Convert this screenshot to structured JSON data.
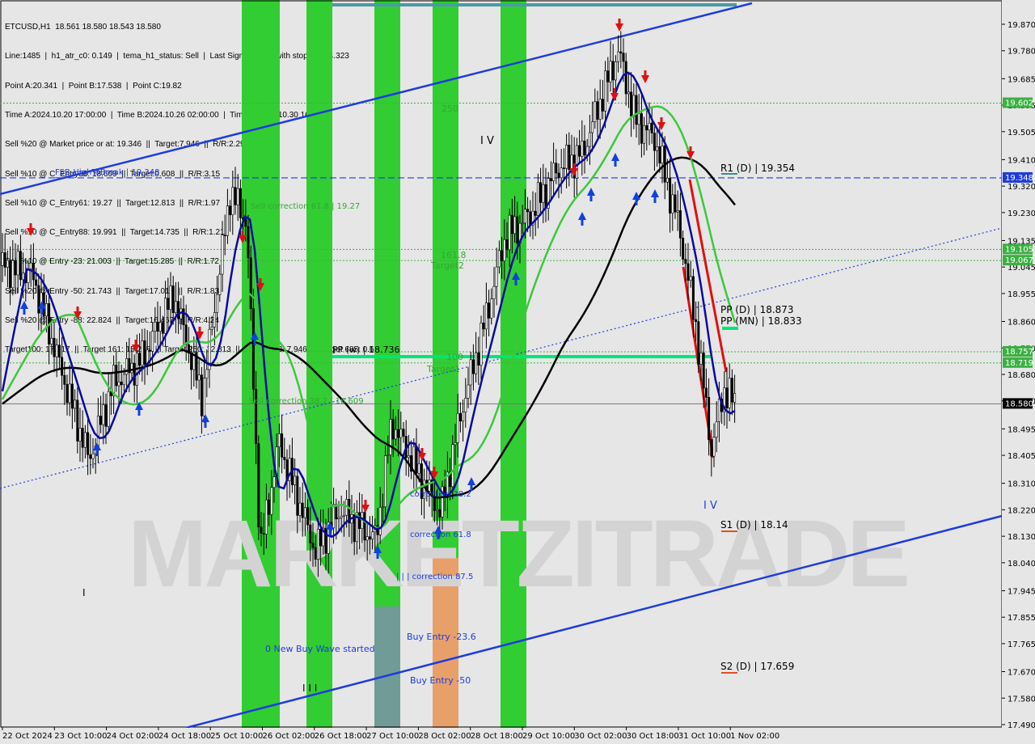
{
  "header": {
    "title": "ETCUSD,H1  18.561 18.580 18.543 18.580",
    "lines": [
      "Line:1485  |  h1_atr_c0: 0.149  |  tema_h1_status: Sell  |  Last Signal is:Sell with stoploss:24.323",
      "Point A:20.341  |  Point B:17.538  |  Point C:19.82",
      "Time A:2024.10.20 17:00:00  |  Time B:2024.10.26 02:00:00  |  Time C:2024.10.30 16:00:00",
      "Sell %20 @ Market price or at: 19.346  ||  Target:7.946  ||  R/R:2.29",
      "Sell %10 @ C_Entry38: 18.609  ||  Target:0.608  ||  R/R:3.15",
      "Sell %10 @ C_Entry61: 19.27  ||  Target:12.813  ||  R/R:1.97",
      "Sell %10 @ C_Entry88: 19.991  ||  Target:14.735  ||  R/R:1.21",
      "Sell %10 @ Entry -23: 21.003  ||  Target:15.285  ||  R/R:1.72",
      "Sell %20 @ Entry -50: 21.743  ||  Target:17.017  ||  R/R:1.83",
      "Sell %20 @ Entry -88: 22.824  ||  Target:16.467  ||  R/R:4.24",
      "Target100: 17.017  ||  Target 161: 15.285  ||  Target 250: 12.813  ||  Target 423: 7.946  ||  Target 685: 0.608"
    ]
  },
  "watermark": "MARKETZITRADE",
  "price_axis": {
    "ticks": [
      "19.870",
      "19.780",
      "19.685",
      "19.595",
      "19.505",
      "19.410",
      "19.320",
      "19.230",
      "19.135",
      "19.045",
      "18.955",
      "18.860",
      "18.770",
      "18.680",
      "18.590",
      "18.495",
      "18.405",
      "18.310",
      "18.220",
      "18.130",
      "18.040",
      "17.945",
      "17.855",
      "17.765",
      "17.670",
      "17.580",
      "17.490"
    ],
    "highlights": [
      {
        "label": "19.602",
        "price": 19.602,
        "color": "#3cb043"
      },
      {
        "label": "19.348",
        "price": 19.348,
        "color": "#1e3cdc"
      },
      {
        "label": "19.105",
        "price": 19.105,
        "color": "#3cb043"
      },
      {
        "label": "19.067",
        "price": 19.067,
        "color": "#3cb043"
      },
      {
        "label": "18.757",
        "price": 18.757,
        "color": "#3cb043"
      },
      {
        "label": "18.719",
        "price": 18.719,
        "color": "#3cb043"
      },
      {
        "label": "18.580",
        "price": 18.58,
        "color": "#000000"
      }
    ]
  },
  "time_axis": {
    "labels": [
      "22 Oct 2024",
      "23 Oct 10:00",
      "24 Oct 02:00",
      "24 Oct 18:00",
      "25 Oct 10:00",
      "26 Oct 02:00",
      "26 Oct 18:00",
      "27 Oct 10:00",
      "28 Oct 02:00",
      "28 Oct 18:00",
      "29 Oct 10:00",
      "30 Oct 02:00",
      "30 Oct 18:00",
      "31 Oct 10:00",
      "1 Nov 02:00"
    ]
  },
  "annotations": {
    "fsb": "FSB-HighToBreak  |  19.348",
    "r1": "R1 (D)  |  19.354",
    "pp_d": "PP (D)  |  18.873",
    "pp_mn": "PP (MN)  |  18.833",
    "pp_w": "PP (w)  |  18.736",
    "s1": "S1 (D)  |  18.14",
    "s2": "S2 (D)  |  17.659",
    "sell_corr_61": "Sell correction 61.8  |  19.27",
    "sell_corr_38": "Sell correction 38.2  |  18.609",
    "label_250": "250",
    "label_1618": "161.8",
    "target2": "Target2",
    "label_100": "100",
    "target1": "Target1",
    "corr_382": "correction 38.2",
    "corr_618": "correction 61.8",
    "corr_875": "| | | correction 87.5",
    "buy_236": "Buy Entry -23.6",
    "buy_50": "Buy Entry -50",
    "new_wave": "0 New Buy Wave started",
    "wave_iv_top": "I V",
    "wave_iv_bottom": "I V",
    "wave_iii": "I I I",
    "wave_i": "I"
  },
  "colors": {
    "background": "#e6e6e6",
    "candle": "#000000",
    "green_zone": "#32cd32",
    "orange_zone": "#e8a06a",
    "teal_zone": "#4a9aa6",
    "ema_blue": "#0a0aa0",
    "ema_green": "#3cc83c",
    "ema_black": "#000000",
    "channel_blue": "#1e3cdc",
    "arrow_red": "#e01010",
    "arrow_blue": "#1040e0",
    "green_line": "#00e676"
  }
}
